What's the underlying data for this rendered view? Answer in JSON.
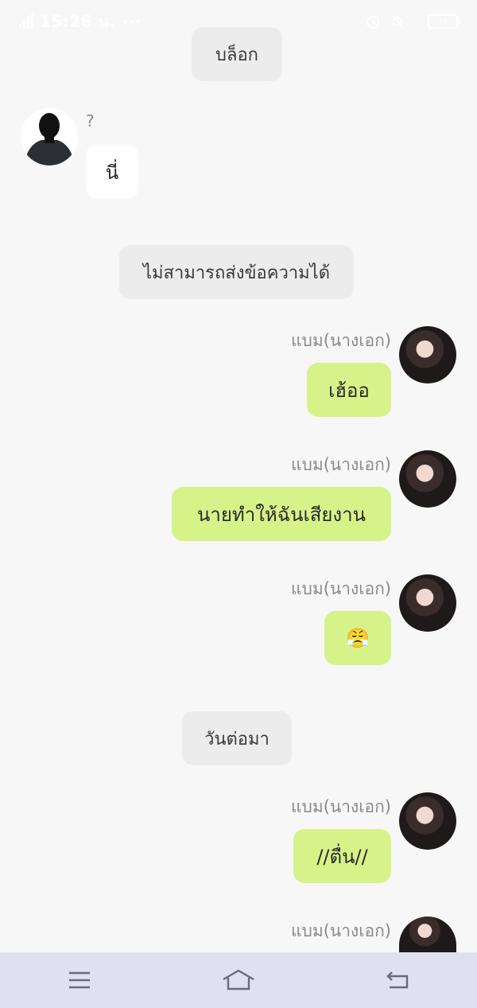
{
  "status_bar": {
    "time": "15:26 น.",
    "more": "···",
    "battery": "78"
  },
  "messages": {
    "system_block": "บล็อก",
    "unknown_user_marker": "?",
    "other_msg": "นี่",
    "system_cannot_send": "ไม่สามารถส่งข้อความได้",
    "sender_name": "แบม(นางเอก)",
    "msg1": "เฮ้ออ",
    "msg2": "นายทำให้ฉันเสียงาน",
    "msg3_emoji": "😤",
    "system_next_day": "วันต่อมา",
    "msg4": "//ตื่น//"
  },
  "nav": {
    "menu_icon": "menu-icon",
    "home_icon": "home-icon",
    "back_icon": "back-icon"
  },
  "colors": {
    "my_bubble": "#d6f38a",
    "system_pill": "#ececec",
    "background": "#f7f7f7",
    "navbar": "#dfe0f0"
  }
}
